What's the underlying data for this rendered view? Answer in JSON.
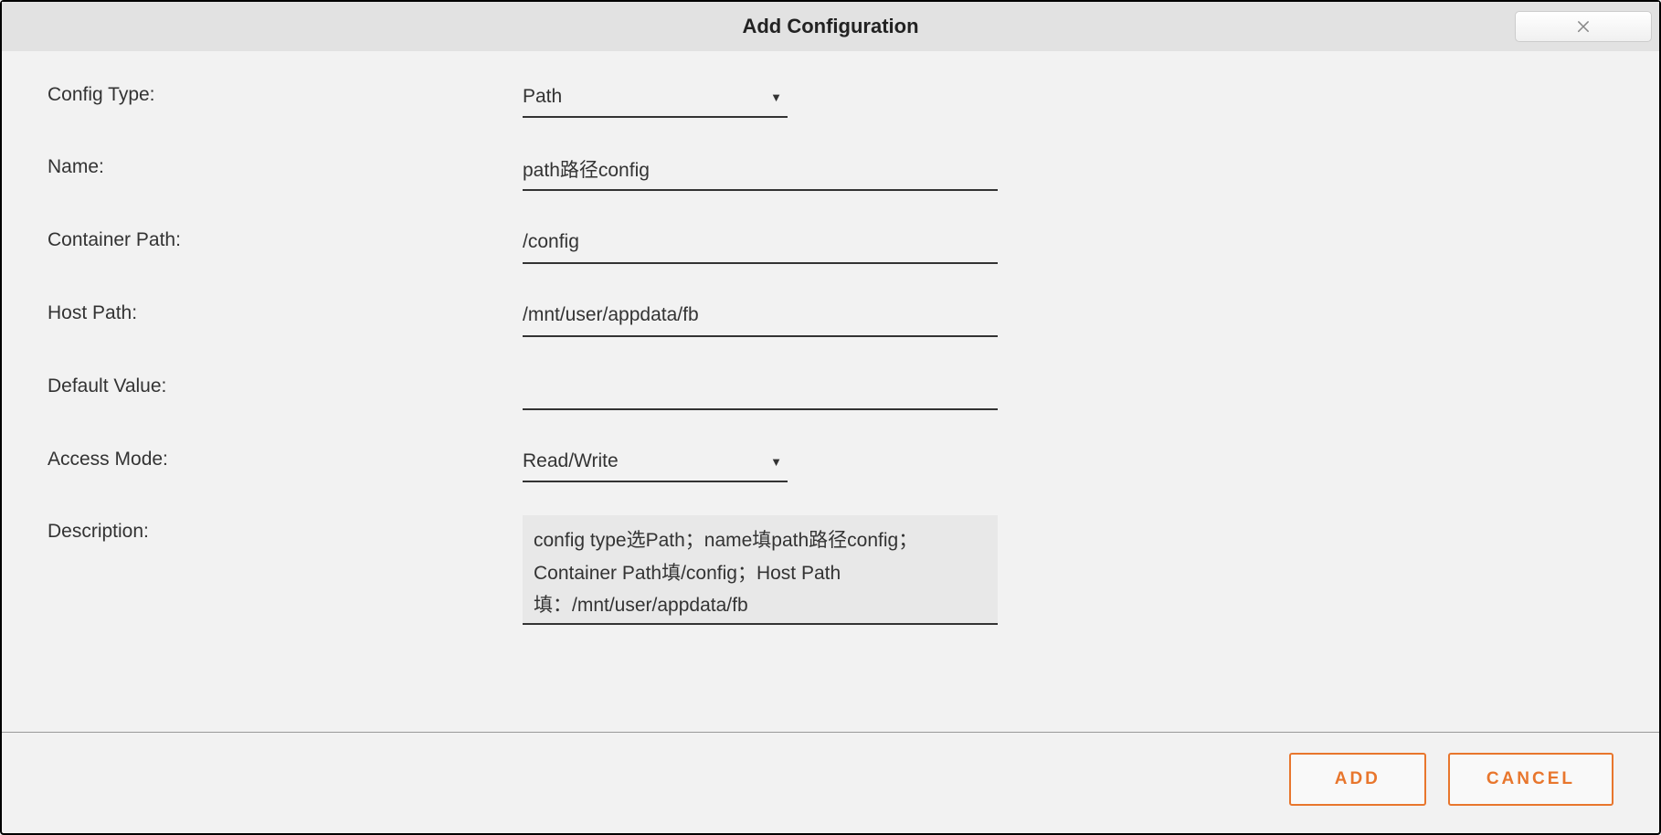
{
  "header": {
    "title": "Add Configuration"
  },
  "form": {
    "config_type": {
      "label": "Config Type:",
      "value": "Path"
    },
    "name": {
      "label": "Name:",
      "value": "path路径config"
    },
    "container_path": {
      "label": "Container Path:",
      "value": "/config"
    },
    "host_path": {
      "label": "Host Path:",
      "value": "/mnt/user/appdata/fb"
    },
    "default_value": {
      "label": "Default Value:",
      "value": ""
    },
    "access_mode": {
      "label": "Access Mode:",
      "value": "Read/Write"
    },
    "description": {
      "label": "Description:",
      "value": "config type选Path；name填path路径config；Container Path填/config；Host Path填：/mnt/user/appdata/fb"
    }
  },
  "footer": {
    "add_label": "ADD",
    "cancel_label": "CANCEL"
  }
}
